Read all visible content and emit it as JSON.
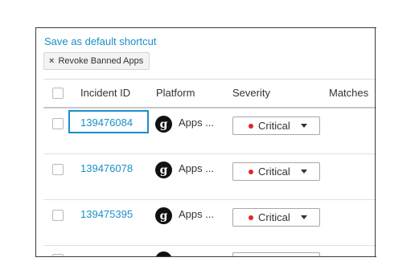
{
  "toolbar": {
    "shortcut_link": "Save as default shortcut",
    "filter_chip": {
      "remove_glyph": "×",
      "label": "Revoke Banned Apps"
    }
  },
  "table": {
    "headers": {
      "incident_id": "Incident ID",
      "platform": "Platform",
      "severity": "Severity",
      "matches": "Matches"
    },
    "rows": [
      {
        "incident_id": "139476084",
        "platform_icon": "g",
        "platform": "Apps ...",
        "severity": "Critical"
      },
      {
        "incident_id": "139476078",
        "platform_icon": "g",
        "platform": "Apps ...",
        "severity": "Critical"
      },
      {
        "incident_id": "139475395",
        "platform_icon": "g",
        "platform": "Apps ...",
        "severity": "Critical"
      }
    ]
  },
  "colors": {
    "link": "#1a8fc9",
    "critical": "#e0262b",
    "platform_icon_bg": "#111111"
  },
  "icons": {
    "chip_remove": "close-icon",
    "platform": "g-logo-icon",
    "severity_dropdown": "caret-down-icon",
    "severity_status": "red-dot-icon"
  }
}
